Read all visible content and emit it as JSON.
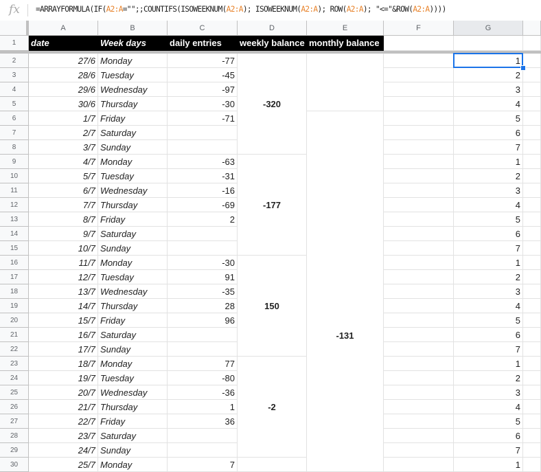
{
  "formula_bar": {
    "icon": "fx-icon",
    "label": "fx",
    "formula_parts": [
      {
        "t": "=ARRAYFORMULA(IF(",
        "ref": false
      },
      {
        "t": "A2:A",
        "ref": true
      },
      {
        "t": "=\"\";;COUNTIFS(ISOWEEKNUM(",
        "ref": false
      },
      {
        "t": "A2:A",
        "ref": true
      },
      {
        "t": "); ISOWEEKNUM(",
        "ref": false
      },
      {
        "t": "A2:A",
        "ref": true
      },
      {
        "t": "); ROW(",
        "ref": false
      },
      {
        "t": "A2:A",
        "ref": true
      },
      {
        "t": "); \"<=\"&ROW(",
        "ref": false
      },
      {
        "t": "A2:A",
        "ref": true
      },
      {
        "t": "))))",
        "ref": false
      }
    ]
  },
  "columns": [
    "A",
    "B",
    "C",
    "D",
    "E",
    "F",
    "G"
  ],
  "selected_column": "G",
  "selected_cell": "G2",
  "header_row": {
    "row_number": "1",
    "cells": [
      "date",
      "Week days",
      "daily entries",
      "weekly balance",
      "monthly balance"
    ]
  },
  "rows": [
    {
      "n": "2",
      "date": "27/6",
      "day": "Monday",
      "entry": "-77",
      "g": "1"
    },
    {
      "n": "3",
      "date": "28/6",
      "day": "Tuesday",
      "entry": "-45",
      "g": "2"
    },
    {
      "n": "4",
      "date": "29/6",
      "day": "Wednesday",
      "entry": "-97",
      "g": "3"
    },
    {
      "n": "5",
      "date": "30/6",
      "day": "Thursday",
      "entry": "-30",
      "g": "4"
    },
    {
      "n": "6",
      "date": "1/7",
      "day": "Friday",
      "entry": "-71",
      "g": "5"
    },
    {
      "n": "7",
      "date": "2/7",
      "day": "Saturday",
      "entry": "",
      "g": "6"
    },
    {
      "n": "8",
      "date": "3/7",
      "day": "Sunday",
      "entry": "",
      "g": "7"
    },
    {
      "n": "9",
      "date": "4/7",
      "day": "Monday",
      "entry": "-63",
      "g": "1"
    },
    {
      "n": "10",
      "date": "5/7",
      "day": "Tuesday",
      "entry": "-31",
      "g": "2"
    },
    {
      "n": "11",
      "date": "6/7",
      "day": "Wednesday",
      "entry": "-16",
      "g": "3"
    },
    {
      "n": "12",
      "date": "7/7",
      "day": "Thursday",
      "entry": "-69",
      "g": "4"
    },
    {
      "n": "13",
      "date": "8/7",
      "day": "Friday",
      "entry": "2",
      "g": "5"
    },
    {
      "n": "14",
      "date": "9/7",
      "day": "Saturday",
      "entry": "",
      "g": "6"
    },
    {
      "n": "15",
      "date": "10/7",
      "day": "Sunday",
      "entry": "",
      "g": "7"
    },
    {
      "n": "16",
      "date": "11/7",
      "day": "Monday",
      "entry": "-30",
      "g": "1"
    },
    {
      "n": "17",
      "date": "12/7",
      "day": "Tuesday",
      "entry": "91",
      "g": "2"
    },
    {
      "n": "18",
      "date": "13/7",
      "day": "Wednesday",
      "entry": "-35",
      "g": "3"
    },
    {
      "n": "19",
      "date": "14/7",
      "day": "Thursday",
      "entry": "28",
      "g": "4"
    },
    {
      "n": "20",
      "date": "15/7",
      "day": "Friday",
      "entry": "96",
      "g": "5"
    },
    {
      "n": "21",
      "date": "16/7",
      "day": "Saturday",
      "entry": "",
      "g": "6"
    },
    {
      "n": "22",
      "date": "17/7",
      "day": "Sunday",
      "entry": "",
      "g": "7"
    },
    {
      "n": "23",
      "date": "18/7",
      "day": "Monday",
      "entry": "77",
      "g": "1"
    },
    {
      "n": "24",
      "date": "19/7",
      "day": "Tuesday",
      "entry": "-80",
      "g": "2"
    },
    {
      "n": "25",
      "date": "20/7",
      "day": "Wednesday",
      "entry": "-36",
      "g": "3"
    },
    {
      "n": "26",
      "date": "21/7",
      "day": "Thursday",
      "entry": "1",
      "g": "4"
    },
    {
      "n": "27",
      "date": "22/7",
      "day": "Friday",
      "entry": "36",
      "g": "5"
    },
    {
      "n": "28",
      "date": "23/7",
      "day": "Saturday",
      "entry": "",
      "g": "6"
    },
    {
      "n": "29",
      "date": "24/7",
      "day": "Sunday",
      "entry": "",
      "g": "7"
    },
    {
      "n": "30",
      "date": "25/7",
      "day": "Monday",
      "entry": "7",
      "g": "1"
    }
  ],
  "weekly_balances": [
    {
      "from_row": 2,
      "to_row": 8,
      "value": "-320"
    },
    {
      "from_row": 9,
      "to_row": 15,
      "value": "-177"
    },
    {
      "from_row": 16,
      "to_row": 22,
      "value": "150"
    },
    {
      "from_row": 23,
      "to_row": 29,
      "value": "-2"
    }
  ],
  "monthly_balances": [
    {
      "from_row": 2,
      "to_row": 5,
      "value": ""
    },
    {
      "from_row": 6,
      "to_row": 36,
      "value": "-131"
    }
  ]
}
